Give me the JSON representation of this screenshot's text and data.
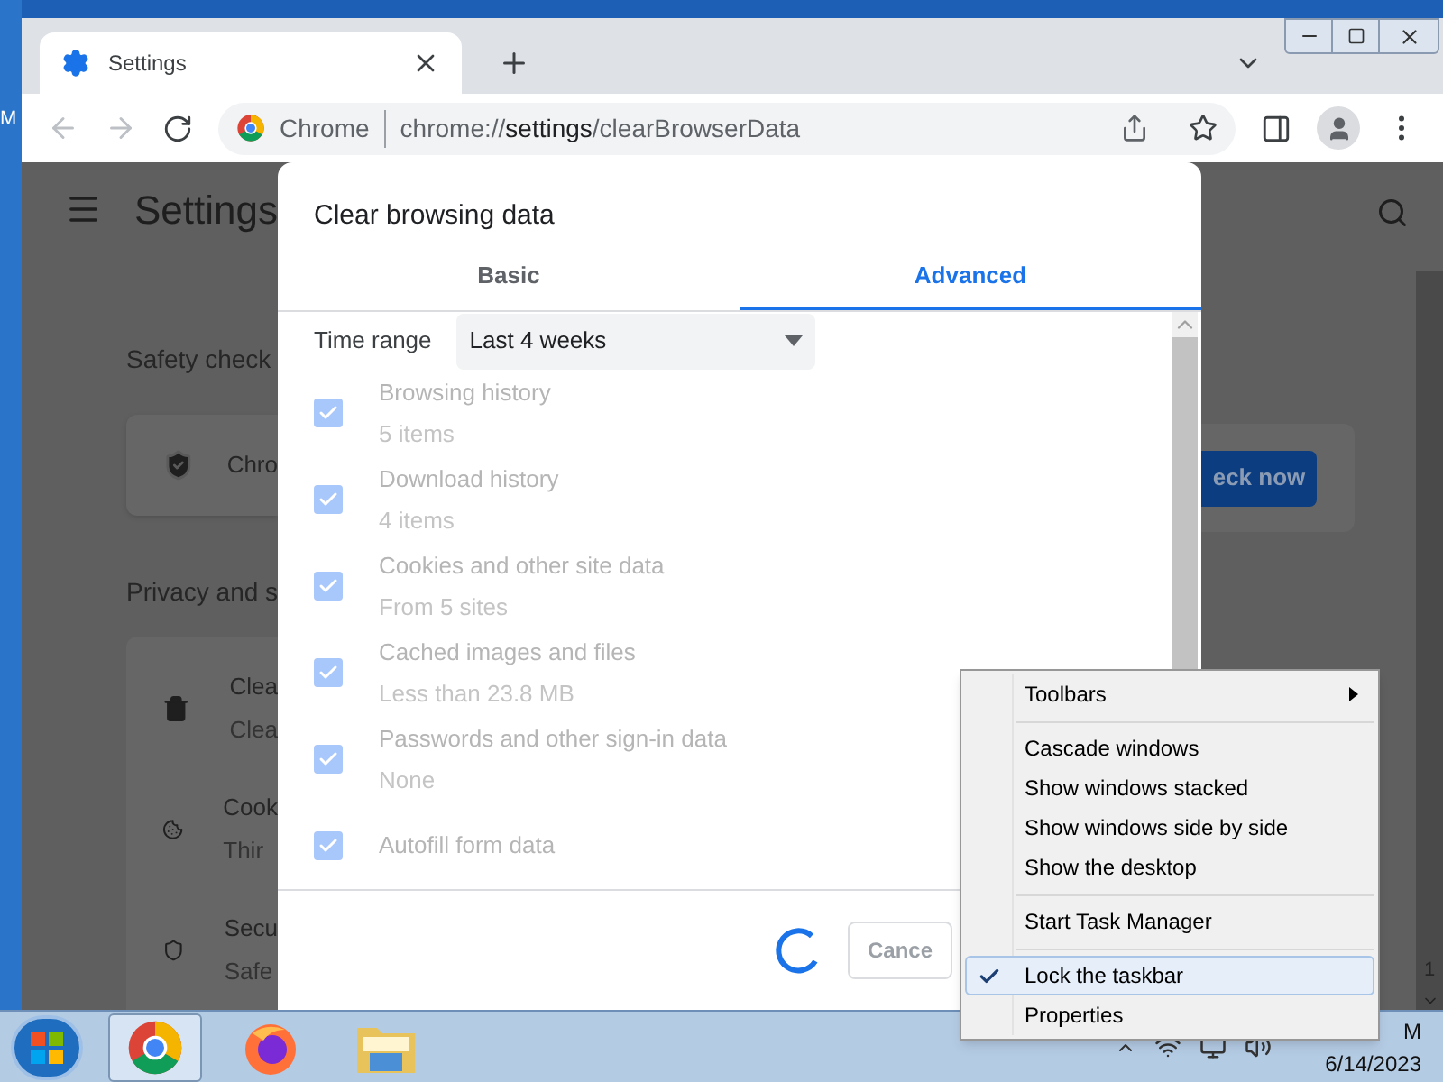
{
  "desktop": {
    "icon_label": "M"
  },
  "tabs": [
    {
      "title": "Settings",
      "selected": true
    }
  ],
  "address_bar": {
    "site_label": "Chrome",
    "url_scheme": "chrome://",
    "url_host": "settings",
    "url_path": "/clearBrowserData"
  },
  "settings_page": {
    "title": "Settings",
    "safety_check": {
      "heading": "Safety check",
      "card_text": "Chro",
      "button": "eck now"
    },
    "privacy": {
      "heading": "Privacy and s",
      "rows": [
        {
          "kind": "trash",
          "title": "Clea",
          "subtitle": "Clea"
        },
        {
          "kind": "cookie",
          "title": "Cook",
          "subtitle": "Thir"
        },
        {
          "kind": "shield",
          "title": "Secu",
          "subtitle": "Safe"
        }
      ]
    },
    "edge_text": "1"
  },
  "dialog": {
    "title": "Clear browsing data",
    "tabs": [
      {
        "label": "Basic",
        "selected": false
      },
      {
        "label": "Advanced",
        "selected": true
      }
    ],
    "time_range": {
      "label": "Time range",
      "value": "Last 4 weeks"
    },
    "items": [
      {
        "title": "Browsing history",
        "detail": "5 items",
        "checked": true,
        "disabled": true
      },
      {
        "title": "Download history",
        "detail": "4 items",
        "checked": true,
        "disabled": true
      },
      {
        "title": "Cookies and other site data",
        "detail": "From 5 sites",
        "checked": true,
        "disabled": true
      },
      {
        "title": "Cached images and files",
        "detail": "Less than 23.8 MB",
        "checked": true,
        "disabled": true
      },
      {
        "title": "Passwords and other sign-in data",
        "detail": "None",
        "checked": true,
        "disabled": true
      },
      {
        "title": "Autofill form data",
        "checked": true,
        "disabled": true
      }
    ],
    "footer": {
      "loading": true,
      "cancel": "Cance"
    }
  },
  "context_menu": {
    "items": [
      {
        "kind": "submenu",
        "label": "Toolbars",
        "checked": false,
        "selected": false
      },
      {
        "kind": "separator"
      },
      {
        "kind": "command",
        "label": "Cascade windows",
        "checked": false,
        "selected": false
      },
      {
        "kind": "command",
        "label": "Show windows stacked",
        "checked": false,
        "selected": false
      },
      {
        "kind": "command",
        "label": "Show windows side by side",
        "checked": false,
        "selected": false
      },
      {
        "kind": "command",
        "label": "Show the desktop",
        "checked": false,
        "selected": false
      },
      {
        "kind": "separator"
      },
      {
        "kind": "command",
        "label": "Start Task Manager",
        "checked": false,
        "selected": false
      },
      {
        "kind": "separator"
      },
      {
        "kind": "command",
        "label": "Lock the taskbar",
        "checked": true,
        "selected": true
      },
      {
        "kind": "command",
        "label": "Properties",
        "checked": false,
        "selected": false
      }
    ]
  },
  "taskbar": {
    "apps": [
      {
        "kind": "chrome",
        "selected": true
      },
      {
        "kind": "firefox",
        "selected": false
      },
      {
        "kind": "explorer",
        "selected": false
      }
    ],
    "clock": {
      "time": "M",
      "date": "6/14/2023"
    }
  }
}
